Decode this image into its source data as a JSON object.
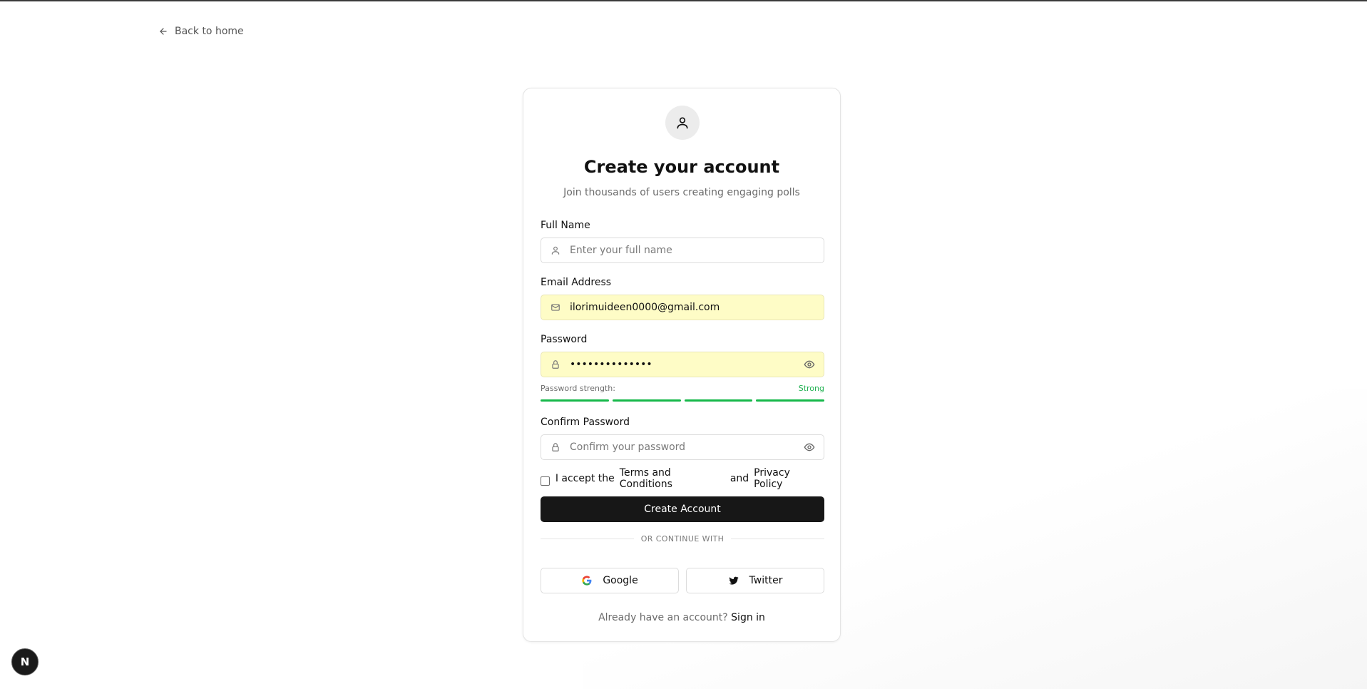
{
  "nav": {
    "back_label": "Back to home",
    "back_icon": "arrow-left-icon"
  },
  "card": {
    "avatar_icon": "user-icon",
    "title": "Create your account",
    "subtitle": "Join thousands of users creating engaging polls"
  },
  "form": {
    "full_name": {
      "label": "Full Name",
      "placeholder": "Enter your full name",
      "value": "",
      "icon": "user-icon"
    },
    "email": {
      "label": "Email Address",
      "placeholder": "",
      "value": "ilorimuideen0000@gmail.com",
      "icon": "mail-icon"
    },
    "password": {
      "label": "Password",
      "value": "••••••••••••••",
      "icon": "lock-icon",
      "toggle_icon": "eye-icon"
    },
    "strength": {
      "label": "Password strength:",
      "value": "Strong",
      "level": 4,
      "max_level": 4,
      "color": "#16b84a"
    },
    "confirm_password": {
      "label": "Confirm Password",
      "placeholder": "Confirm your password",
      "value": "",
      "icon": "lock-icon",
      "toggle_icon": "eye-icon"
    },
    "terms": {
      "prefix": "I accept the",
      "terms_link": "Terms and Conditions",
      "conjunction": "and",
      "privacy_link": "Privacy Policy",
      "checked": false
    },
    "submit_label": "Create Account"
  },
  "social": {
    "divider_text": "OR CONTINUE WITH",
    "google_label": "Google",
    "twitter_label": "Twitter"
  },
  "footer": {
    "signin_prompt": "Already have an account?",
    "signin_link": "Sign in"
  },
  "dev_badge": {
    "letter": "N"
  },
  "colors": {
    "primary": "#171717",
    "autofill_bg": "#fefcc6",
    "success": "#22b152"
  }
}
